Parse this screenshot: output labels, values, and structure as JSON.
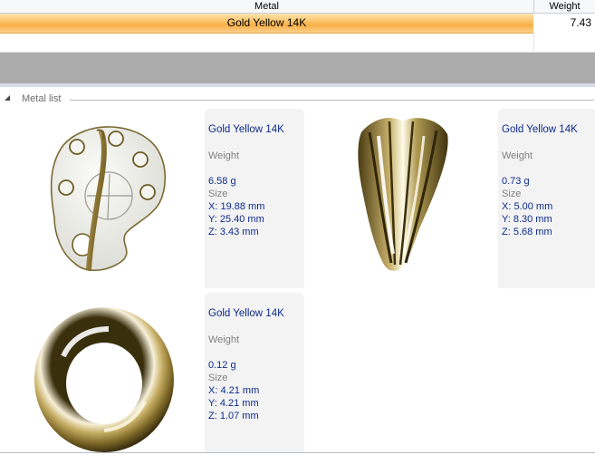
{
  "grid": {
    "columns": {
      "metal": "Metal",
      "weight": "Weight"
    },
    "rows": [
      {
        "metal": "Gold Yellow 14K",
        "weight": "7.43"
      }
    ]
  },
  "group": {
    "title": "Metal list"
  },
  "items": [
    {
      "metal": "Gold Yellow 14K",
      "weight_label": "Weight",
      "weight": "6.58 g",
      "size_label": "Size",
      "x": "X: 19.88 mm",
      "y": "Y: 25.40 mm",
      "z": "Z: 3.43 mm",
      "thumbnail": "palette-pendant"
    },
    {
      "metal": "Gold Yellow 14K",
      "weight_label": "Weight",
      "weight": "0.73 g",
      "size_label": "Size",
      "x": "X: 5.00 mm",
      "y": "Y: 8.30 mm",
      "z": "Z: 5.68 mm",
      "thumbnail": "fluted-bail"
    },
    {
      "metal": "Gold Yellow 14K",
      "weight_label": "Weight",
      "weight": "0.12 g",
      "size_label": "Size",
      "x": "X: 4.21 mm",
      "y": "Y: 4.21 mm",
      "z": "Z: 1.07 mm",
      "thumbnail": "jump-ring"
    }
  ],
  "colors": {
    "selection": "#f9b046",
    "metal_text": "#0c2a8a",
    "band": "#ababab"
  }
}
